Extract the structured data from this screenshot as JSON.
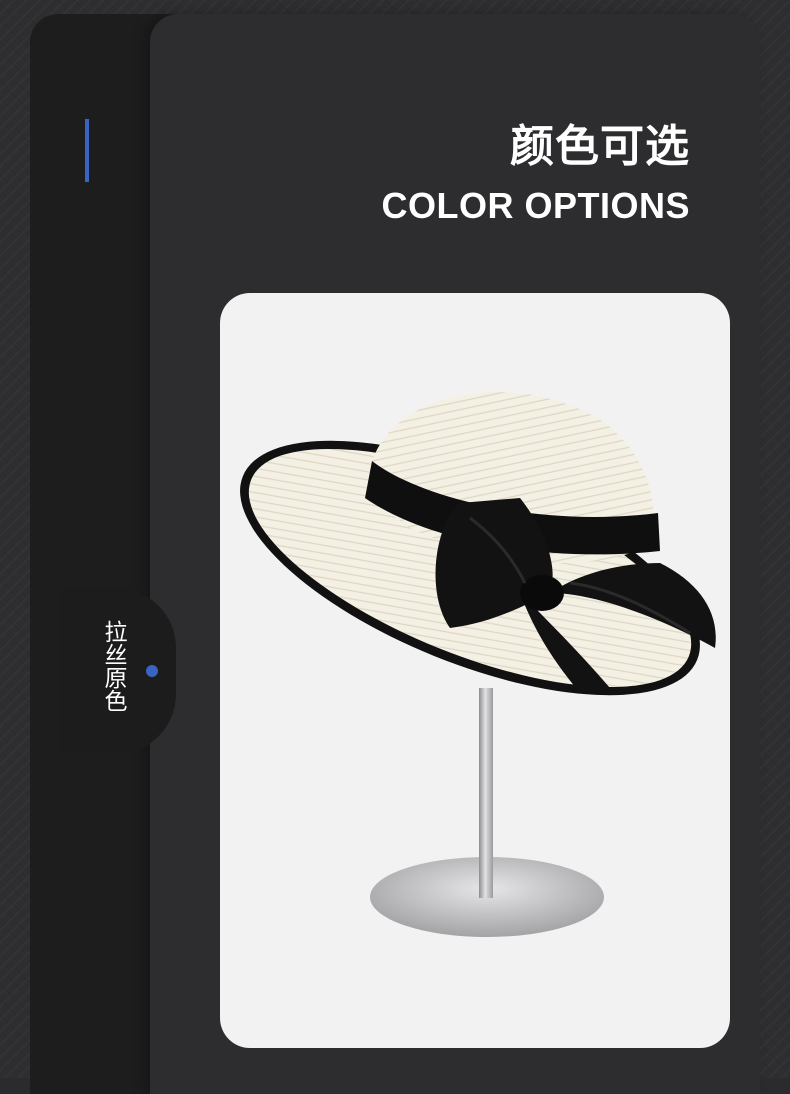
{
  "header": {
    "title_cn": "颜色可选",
    "title_en": "COLOR OPTIONS"
  },
  "color_selector": {
    "selected_label": "拉丝原色"
  },
  "colors": {
    "accent": "#3b63c4",
    "panel": "#2d2d2f",
    "rail": "#1d1d1e",
    "card": "#f2f2f2"
  },
  "product_image": {
    "icon": "straw-hat-with-black-bow-on-stand"
  }
}
